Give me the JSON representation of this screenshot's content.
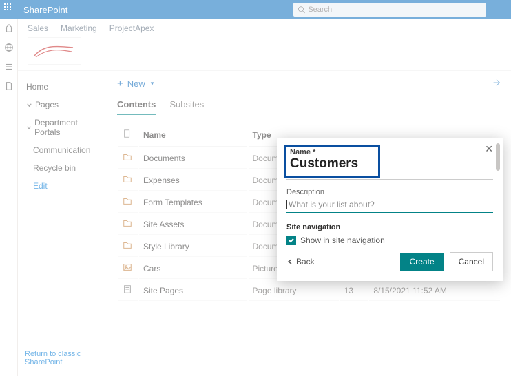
{
  "suite": {
    "title": "SharePoint"
  },
  "search": {
    "placeholder": "Search"
  },
  "breadcrumbs": [
    "Sales",
    "Marketing",
    "ProjectApex"
  ],
  "leftnav": {
    "home": "Home",
    "pages": "Pages",
    "dept": "Department Portals",
    "comm": "Communication",
    "recycle": "Recycle bin",
    "edit": "Edit",
    "return": "Return to classic SharePoint"
  },
  "cmdbar": {
    "new": "New"
  },
  "tabs": {
    "contents": "Contents",
    "subsites": "Subsites"
  },
  "table": {
    "headers": {
      "name": "Name",
      "type": "Type",
      "items": "",
      "modified": ""
    },
    "rows": [
      {
        "name": "Documents",
        "type": "Document lib",
        "items": "",
        "modified": ""
      },
      {
        "name": "Expenses",
        "type": "Document lib",
        "items": "",
        "modified": ""
      },
      {
        "name": "Form Templates",
        "type": "Document lib",
        "items": "",
        "modified": ""
      },
      {
        "name": "Site Assets",
        "type": "Document lib",
        "items": "",
        "modified": ""
      },
      {
        "name": "Style Library",
        "type": "Document lib",
        "items": "",
        "modified": ""
      },
      {
        "name": "Cars",
        "type": "Picture librar",
        "items": "",
        "modified": ""
      },
      {
        "name": "Site Pages",
        "type": "Page library",
        "items": "13",
        "modified": "8/15/2021 11:52 AM"
      }
    ]
  },
  "dialog": {
    "name_label": "Name *",
    "name_value": "Customers",
    "desc_label": "Description",
    "desc_placeholder": "What is your list about?",
    "sitenav_label": "Site navigation",
    "sitenav_check": "Show in site navigation",
    "back": "Back",
    "create": "Create",
    "cancel": "Cancel"
  }
}
